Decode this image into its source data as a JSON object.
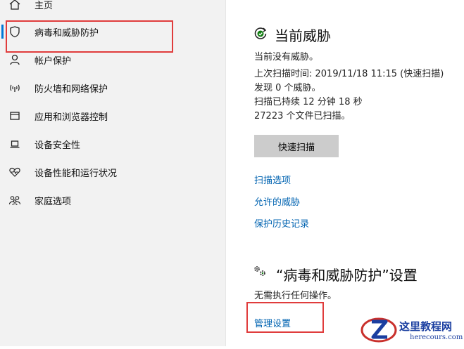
{
  "sidebar": {
    "items": [
      {
        "label": "主页",
        "icon": "home-icon"
      },
      {
        "label": "病毒和威胁防护",
        "icon": "shield-icon",
        "active": true
      },
      {
        "label": "帐户保护",
        "icon": "person-icon"
      },
      {
        "label": "防火墙和网络保护",
        "icon": "wifi-signal-icon"
      },
      {
        "label": "应用和浏览器控制",
        "icon": "app-window-icon"
      },
      {
        "label": "设备安全性",
        "icon": "laptop-icon"
      },
      {
        "label": "设备性能和运行状况",
        "icon": "heart-pulse-icon"
      },
      {
        "label": "家庭选项",
        "icon": "family-icon"
      }
    ]
  },
  "threats": {
    "title": "当前威胁",
    "no_threats": "当前没有威胁。",
    "last_scan": "上次扫描时间: 2019/11/18 11:15 (快速扫描)",
    "found": "发现 0 个威胁。",
    "duration": "扫描已持续 12 分钟 18 秒",
    "files_scanned": "27223 个文件已扫描。",
    "quick_scan_label": "快速扫描",
    "links": [
      "扫描选项",
      "允许的威胁",
      "保护历史记录"
    ]
  },
  "settings": {
    "title": "“病毒和威胁防护”设置",
    "no_action": "无需执行任何操作。",
    "manage_label": "管理设置"
  },
  "watermark": {
    "line1": "这里教程网",
    "line2": "herecours.com"
  },
  "colors": {
    "accent": "#0078d7",
    "link": "#0063b1",
    "highlight_box": "#e03c3c",
    "status_ok": "#107c10"
  }
}
